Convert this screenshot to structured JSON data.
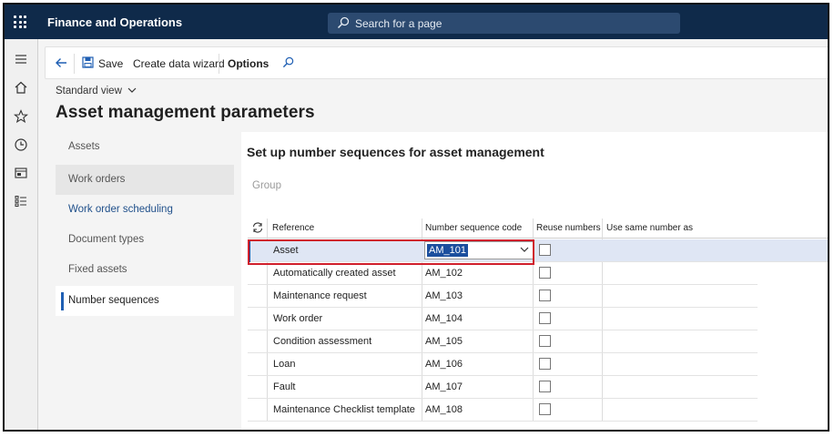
{
  "app": {
    "title": "Finance and Operations"
  },
  "search": {
    "placeholder": "Search for a page"
  },
  "actions": {
    "save": "Save",
    "wizard": "Create data wizard",
    "options": "Options"
  },
  "view": {
    "label": "Standard view"
  },
  "page": {
    "title": "Asset management parameters"
  },
  "tabs": [
    "Assets",
    "Work orders",
    "Work order scheduling",
    "Document types",
    "Fixed assets",
    "Number sequences"
  ],
  "section": {
    "title": "Set up number sequences for asset management",
    "group_label": "Group"
  },
  "grid": {
    "columns": [
      "Reference",
      "Number sequence code",
      "Reuse numbers",
      "Use same number as"
    ],
    "rows": [
      {
        "reference": "Asset",
        "code": "AM_101"
      },
      {
        "reference": "Automatically created asset",
        "code": "AM_102"
      },
      {
        "reference": "Maintenance request",
        "code": "AM_103"
      },
      {
        "reference": "Work order",
        "code": "AM_104"
      },
      {
        "reference": "Condition assessment",
        "code": "AM_105"
      },
      {
        "reference": "Loan",
        "code": "AM_106"
      },
      {
        "reference": "Fault",
        "code": "AM_107"
      },
      {
        "reference": "Maintenance Checklist template",
        "code": "AM_108"
      }
    ]
  },
  "colors": {
    "topbar": "#0f2a4a",
    "accent": "#1f5fb3",
    "highlight_border": "#d0202c"
  }
}
